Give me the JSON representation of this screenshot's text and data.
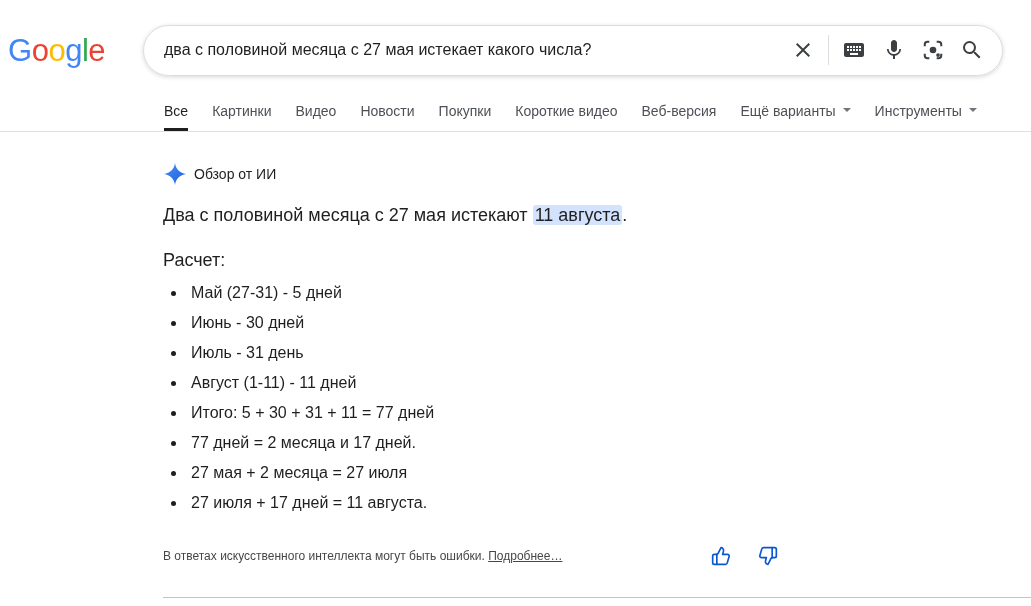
{
  "logo": "Google",
  "search": {
    "value": "два с половиной месяца с 27 мая истекает какого числа?"
  },
  "tabs": [
    {
      "label": "Все",
      "selected": true,
      "kind": "link"
    },
    {
      "label": "Картинки",
      "selected": false,
      "kind": "link"
    },
    {
      "label": "Видео",
      "selected": false,
      "kind": "link"
    },
    {
      "label": "Новости",
      "selected": false,
      "kind": "link"
    },
    {
      "label": "Покупки",
      "selected": false,
      "kind": "link"
    },
    {
      "label": "Короткие видео",
      "selected": false,
      "kind": "link"
    },
    {
      "label": "Веб-версия",
      "selected": false,
      "kind": "link"
    },
    {
      "label": "Ещё варианты",
      "selected": false,
      "kind": "menu"
    },
    {
      "label": "Инструменты",
      "selected": false,
      "kind": "menu"
    }
  ],
  "ai_overview": {
    "title": "Обзор от ИИ",
    "answer": {
      "before": "Два с половиной месяца с 27 мая истекают ",
      "highlight": "11 августа",
      "after": "."
    },
    "heading": "Расчет:",
    "items": [
      "Май (27-31) - 5 дней",
      "Июнь - 30 дней",
      "Июль - 31 день",
      "Август (1-11) - 11 дней",
      "Итого: 5 + 30 + 31 + 11 = 77 дней",
      "77 дней = 2 месяца и 17 дней.",
      "27 мая + 2 месяца = 27 июля",
      "27 июля + 17 дней = 11 августа."
    ],
    "disclaimer": "В ответах искусственного интеллекта могут быть ошибки.",
    "link": "Подробнее…"
  }
}
